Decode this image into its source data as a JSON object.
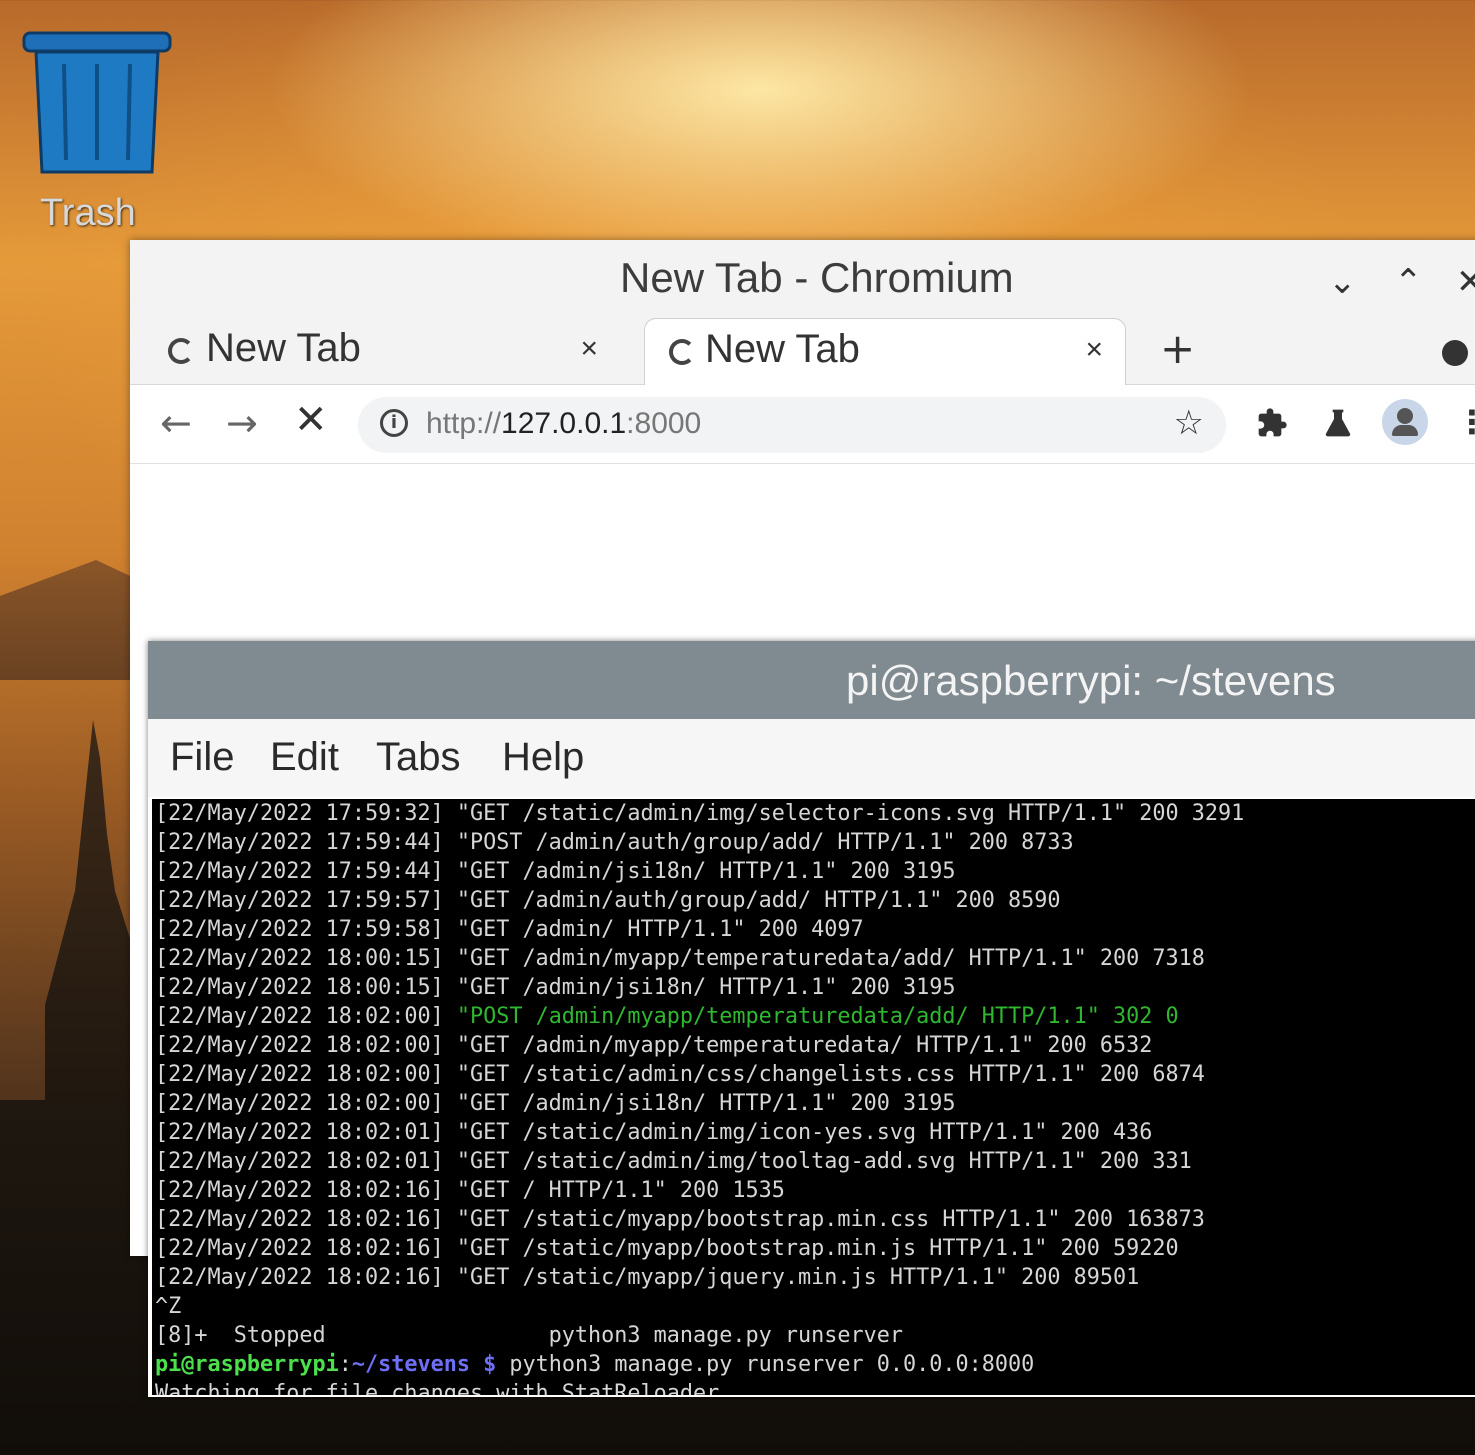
{
  "desktop": {
    "trash_label": "Trash"
  },
  "chromium": {
    "window_title": "New Tab - Chromium",
    "tabs": [
      {
        "label": "New Tab",
        "close": "×",
        "active": false
      },
      {
        "label": "New Tab",
        "close": "×",
        "active": true
      }
    ],
    "new_tab": "+",
    "url_scheme": "http://",
    "url_host": "127.0.0.1",
    "url_port": ":8000"
  },
  "terminal": {
    "title": "pi@raspberrypi: ~/stevens",
    "menu": [
      "File",
      "Edit",
      "Tabs",
      "Help"
    ],
    "lines": [
      "[22/May/2022 17:59:32] \"GET /static/admin/img/selector-icons.svg HTTP/1.1\" 200 3291",
      "[22/May/2022 17:59:44] \"POST /admin/auth/group/add/ HTTP/1.1\" 200 8733",
      "[22/May/2022 17:59:44] \"GET /admin/jsi18n/ HTTP/1.1\" 200 3195",
      "[22/May/2022 17:59:57] \"GET /admin/auth/group/add/ HTTP/1.1\" 200 8590",
      "[22/May/2022 17:59:58] \"GET /admin/ HTTP/1.1\" 200 4097",
      "[22/May/2022 18:00:15] \"GET /admin/myapp/temperaturedata/add/ HTTP/1.1\" 200 7318",
      "[22/May/2022 18:00:15] \"GET /admin/jsi18n/ HTTP/1.1\" 200 3195",
      "\"POST /admin/myapp/temperaturedata/add/ HTTP/1.1\" 302 0",
      "[22/May/2022 18:02:00] \"GET /admin/myapp/temperaturedata/ HTTP/1.1\" 200 6532",
      "[22/May/2022 18:02:00] \"GET /static/admin/css/changelists.css HTTP/1.1\" 200 6874",
      "[22/May/2022 18:02:00] \"GET /admin/jsi18n/ HTTP/1.1\" 200 3195",
      "[22/May/2022 18:02:01] \"GET /static/admin/img/icon-yes.svg HTTP/1.1\" 200 436",
      "[22/May/2022 18:02:01] \"GET /static/admin/img/tooltag-add.svg HTTP/1.1\" 200 331",
      "[22/May/2022 18:02:16] \"GET / HTTP/1.1\" 200 1535",
      "[22/May/2022 18:02:16] \"GET /static/myapp/bootstrap.min.css HTTP/1.1\" 200 163873",
      "[22/May/2022 18:02:16] \"GET /static/myapp/bootstrap.min.js HTTP/1.1\" 200 59220",
      "[22/May/2022 18:02:16] \"GET /static/myapp/jquery.min.js HTTP/1.1\" 200 89501",
      "^Z",
      "[8]+  Stopped                 python3 manage.py runserver"
    ],
    "green_line_prefix": "[22/May/2022 18:02:00] ",
    "prompt_user": "pi@raspberrypi",
    "prompt_sep": ":",
    "prompt_path": "~/stevens $",
    "prompt_command": " python3 manage.py runserver 0.0.0.0:8000",
    "last_line": "Watching for file changes with StatReloader",
    "highlight_color": "#2fb82f"
  }
}
